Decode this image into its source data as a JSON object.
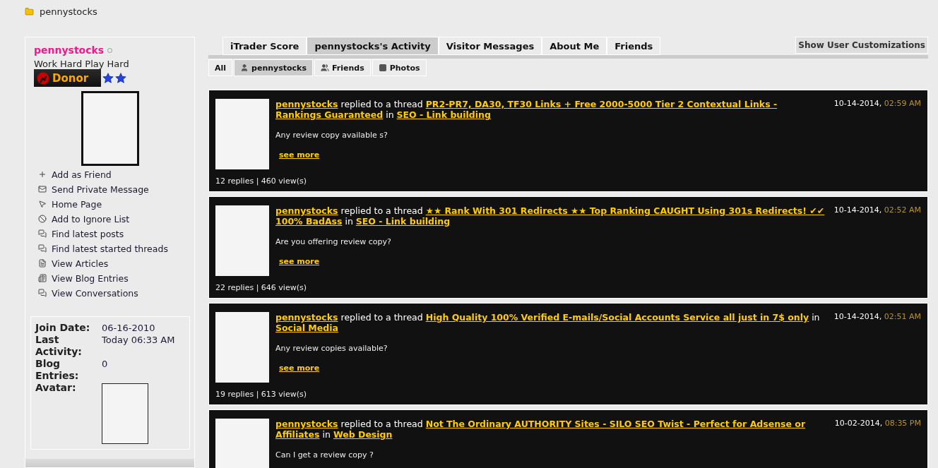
{
  "breadcrumb": {
    "label": "pennystocks"
  },
  "profile": {
    "username": "pennystocks",
    "online": false,
    "title": "Work Hard Play Hard",
    "badge": "Donor"
  },
  "actions": [
    {
      "kind": "add",
      "label": "Add as Friend"
    },
    {
      "kind": "mail",
      "label": "Send Private Message"
    },
    {
      "kind": "home",
      "label": "Home Page"
    },
    {
      "kind": "ignore",
      "label": "Add to Ignore List"
    },
    {
      "kind": "posts",
      "label": "Find latest posts"
    },
    {
      "kind": "posts",
      "label": "Find latest started threads"
    },
    {
      "kind": "articles",
      "label": "View Articles"
    },
    {
      "kind": "blog",
      "label": "View Blog Entries"
    },
    {
      "kind": "posts",
      "label": "View Conversations"
    }
  ],
  "info": [
    {
      "label": "Join Date:",
      "value": "06-16-2010"
    },
    {
      "label": "Last Activity:",
      "value": "Today 06:33 AM"
    },
    {
      "label": "Blog Entries:",
      "value": "0"
    },
    {
      "label": "Avatar:",
      "kind": "avatar"
    }
  ],
  "tabs": [
    {
      "label": "iTrader Score",
      "selected": false
    },
    {
      "label": "pennystocks's Activity",
      "selected": true
    },
    {
      "label": "Visitor Messages",
      "selected": false
    },
    {
      "label": "About Me",
      "selected": false
    },
    {
      "label": "Friends",
      "selected": false
    }
  ],
  "customize_button": "Show User Customizations",
  "subtabs": [
    {
      "label": "All",
      "kind": "all",
      "selected": false
    },
    {
      "label": "pennystocks",
      "kind": "user",
      "selected": true
    },
    {
      "label": "Friends",
      "kind": "friends",
      "selected": false
    },
    {
      "label": "Photos",
      "kind": "photos",
      "selected": false
    }
  ],
  "activity": [
    {
      "user": "pennystocks",
      "action": "replied to a thread",
      "thread": "PR2-PR7, DA30, TF30 Links + Free 2000-5000 Tier 2 Contextual Links - Rankings Guaranteed",
      "in": "in",
      "forum": "SEO - Link building",
      "date": "10-14-2014,",
      "time": "02:59 AM",
      "snippet": "Any review copy available s?",
      "see_more": "see more",
      "stats": "12 replies | 460 view(s)"
    },
    {
      "user": "pennystocks",
      "action": "replied to a thread",
      "thread": "★★ Rank With 301 Redirects ★★ Top Ranking CAUGHT Using 301s Redirects! ✔✔ 100% BadAss",
      "in": "in",
      "forum": "SEO - Link building",
      "date": "10-14-2014,",
      "time": "02:52 AM",
      "snippet": "Are you offering review copy?",
      "see_more": "see more",
      "stats": "22 replies | 646 view(s)"
    },
    {
      "user": "pennystocks",
      "action": "replied to a thread",
      "thread": "High Quality 100% Verified E-mails/Social Accounts Service all just in 7$ only",
      "in": "in",
      "forum": "Social Media",
      "date": "10-14-2014,",
      "time": "02:51 AM",
      "snippet": "Any review copies available?",
      "see_more": "see more",
      "stats": "19 replies | 613 view(s)"
    },
    {
      "user": "pennystocks",
      "action": "replied to a thread",
      "thread": "Not The Ordinary AUTHORITY Sites - SILO SEO Twist - Perfect for Adsense or Affiliates",
      "in": "in",
      "forum": "Web Design",
      "date": "10-02-2014,",
      "time": "08:35 PM",
      "snippet": "Can I get a review copy ?"
    }
  ]
}
